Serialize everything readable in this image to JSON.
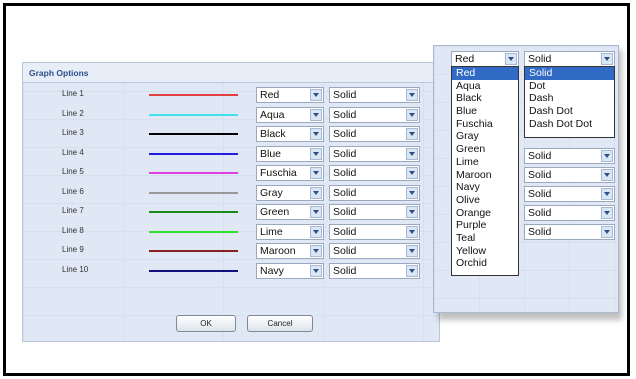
{
  "dialog": {
    "title": "Graph Options",
    "ok_label": "OK",
    "cancel_label": "Cancel",
    "rows": [
      {
        "label": "Line 1",
        "color_value": "Red",
        "style_value": "Solid",
        "swatch": "#e04040"
      },
      {
        "label": "Line 2",
        "color_value": "Aqua",
        "style_value": "Solid",
        "swatch": "#40e0f0"
      },
      {
        "label": "Line 3",
        "color_value": "Black",
        "style_value": "Solid",
        "swatch": "#000000"
      },
      {
        "label": "Line 4",
        "color_value": "Blue",
        "style_value": "Solid",
        "swatch": "#2020e0"
      },
      {
        "label": "Line 5",
        "color_value": "Fuschia",
        "style_value": "Solid",
        "swatch": "#e040e0"
      },
      {
        "label": "Line 6",
        "color_value": "Gray",
        "style_value": "Solid",
        "swatch": "#999999"
      },
      {
        "label": "Line 7",
        "color_value": "Green",
        "style_value": "Solid",
        "swatch": "#1a8a1a"
      },
      {
        "label": "Line 8",
        "color_value": "Lime",
        "style_value": "Solid",
        "swatch": "#30e030"
      },
      {
        "label": "Line 9",
        "color_value": "Maroon",
        "style_value": "Solid",
        "swatch": "#8a2020"
      },
      {
        "label": "Line 10",
        "color_value": "Navy",
        "style_value": "Solid",
        "swatch": "#101080"
      }
    ]
  },
  "popup": {
    "color_select_value": "Red",
    "style_select_value": "Solid",
    "color_options": [
      "Red",
      "Aqua",
      "Black",
      "Blue",
      "Fuschia",
      "Gray",
      "Green",
      "Lime",
      "Maroon",
      "Navy",
      "Olive",
      "Orange",
      "Purple",
      "Teal",
      "Yellow",
      "Orchid"
    ],
    "style_options": [
      "Solid",
      "Dot",
      "Dash",
      "Dash Dot",
      "Dash Dot Dot"
    ],
    "extra_style_selects": [
      "Solid",
      "Solid",
      "Solid",
      "Solid",
      "Solid"
    ]
  }
}
